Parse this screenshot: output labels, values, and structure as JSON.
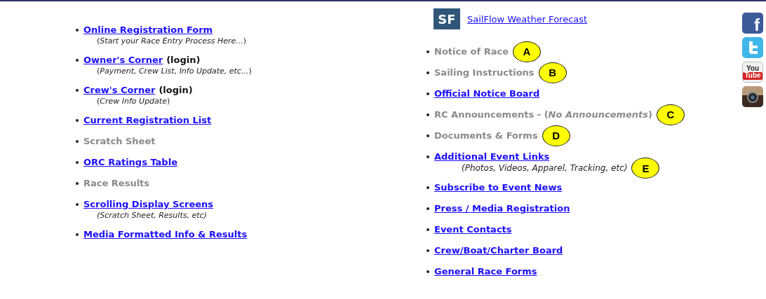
{
  "left_links": [
    {
      "label": "Online Registration Form",
      "kind": "link",
      "note": "(*Start your Race Entry Process Here...*)"
    },
    {
      "label": "Owner's Corner",
      "kind": "link",
      "suffix": "(login)",
      "note": "(*Payment, Crew List, Info Update, etc...*)"
    },
    {
      "label": "Crew's Corner",
      "kind": "link",
      "suffix": "(login)",
      "note": "(*Crew Info Update*)"
    },
    {
      "label": "Current Registration List",
      "kind": "link"
    },
    {
      "label": "Scratch Sheet",
      "kind": "inactive"
    },
    {
      "label": "ORC Ratings Table",
      "kind": "link"
    },
    {
      "label": "Race Results",
      "kind": "inactive"
    },
    {
      "label": "Scrolling Display Screens",
      "kind": "link",
      "note": "*(Scratch Sheet, Results, etc)*"
    },
    {
      "label": "Media Formatted Info & Results",
      "kind": "link"
    }
  ],
  "sailflow": {
    "logo": "SF",
    "label": "SailFlow Weather Forecast"
  },
  "right_links": [
    {
      "label": "Notice of Race",
      "kind": "inactive",
      "badge": "A"
    },
    {
      "label": "Sailing Instructions",
      "kind": "inactive",
      "badge": "B"
    },
    {
      "label": "Official Notice Board",
      "kind": "link"
    },
    {
      "label": "RC Announcements - (*No Announcements*)",
      "kind": "inactive",
      "badge": "C"
    },
    {
      "label": "Documents & Forms",
      "kind": "inactive",
      "badge": "D"
    },
    {
      "label": "Additional Event Links",
      "kind": "link",
      "note": "*(Photos, Videos, Apparel, Tracking, etc)*",
      "badge": "E"
    },
    {
      "label": "Subscribe to Event News",
      "kind": "link"
    },
    {
      "label": "Press /  Media Registration",
      "kind": "link"
    },
    {
      "label": "Event Contacts",
      "kind": "link"
    },
    {
      "label": "Crew/Boat/Charter Board",
      "kind": "link"
    },
    {
      "label": "General Race Forms",
      "kind": "link"
    }
  ],
  "social": [
    {
      "kind": "facebook",
      "text": "f"
    },
    {
      "kind": "twitter"
    },
    {
      "kind": "youtube",
      "text": "You",
      "text2": "Tube"
    },
    {
      "kind": "instagram"
    }
  ]
}
